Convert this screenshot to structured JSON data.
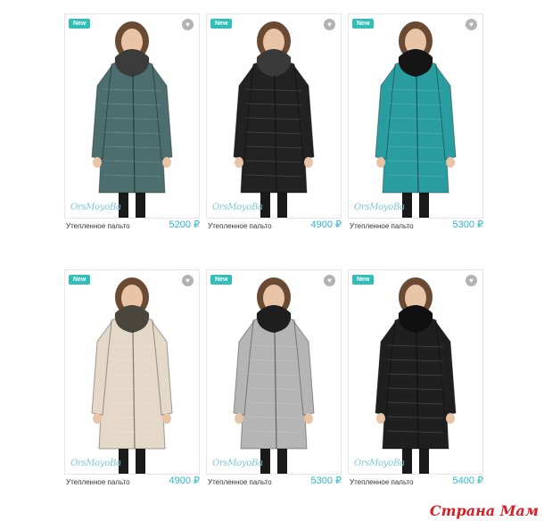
{
  "products": [
    {
      "badge": "New",
      "brand": "OrsMoyoBa",
      "name": "Утепленное пальто",
      "price": "5200 ₽",
      "coat_color": "#4d6e6e",
      "collar_color": "#3b3b3b"
    },
    {
      "badge": "New",
      "brand": "OrsMoyoBa",
      "name": "Утепленное пальто",
      "price": "4900 ₽",
      "coat_color": "#222222",
      "collar_color": "#3a3a3a"
    },
    {
      "badge": "New",
      "brand": "OrsMoyoBa",
      "name": "Утепленное пальто",
      "price": "5300 ₽",
      "coat_color": "#2a9da0",
      "collar_color": "#151515"
    },
    {
      "badge": "New",
      "brand": "OrsMoyoBa",
      "name": "Утепленное пальто",
      "price": "4900 ₽",
      "coat_color": "#e4d8c8",
      "collar_color": "#4a463e"
    },
    {
      "badge": "New",
      "brand": "OrsMoyoBa",
      "name": "Утепленное пальто",
      "price": "5300 ₽",
      "coat_color": "#b5b5b5",
      "collar_color": "#1e1e1e"
    },
    {
      "badge": "New",
      "brand": "OrsMoyoBa",
      "name": "Утепленное пальто",
      "price": "5400 ₽",
      "coat_color": "#1f1f1f",
      "collar_color": "#101010"
    }
  ],
  "watermark": "Страна Мам",
  "colors": {
    "accent": "#2fbfb6",
    "price": "#2fb7c8",
    "watermark": "#d81f26"
  }
}
